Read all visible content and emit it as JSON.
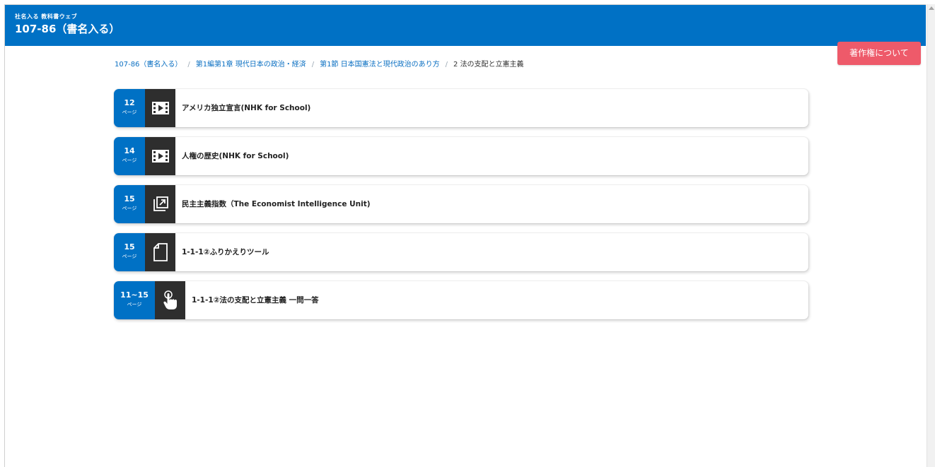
{
  "header": {
    "sub": "社名入る 教科書ウェブ",
    "title": "107-86（書名入る）"
  },
  "breadcrumb": [
    "107-86（書名入る）",
    "第1編第1章 現代日本の政治・経済",
    "第1節 日本国憲法と現代政治のあり方",
    "2 法の支配と立憲主義"
  ],
  "breadcrumb_separator": "/",
  "copyright_button": "著作権について",
  "items": [
    {
      "page": "12",
      "unit": "ページ",
      "icon": "video-icon",
      "label": "アメリカ独立宣言(NHK for School)"
    },
    {
      "page": "14",
      "unit": "ページ",
      "icon": "video-icon",
      "label": "人権の歴史(NHK for School)"
    },
    {
      "page": "15",
      "unit": "ページ",
      "icon": "external-link-icon",
      "label": "民主主義指数（The Economist Intelligence Unit)"
    },
    {
      "page": "15",
      "unit": "ページ",
      "icon": "document-icon",
      "label": "1-1-1②ふりかえりツール"
    },
    {
      "page": "11~15",
      "unit": "ページ",
      "icon": "tap-icon",
      "label": "1-1-1②法の支配と立憲主義 一問一答"
    }
  ]
}
